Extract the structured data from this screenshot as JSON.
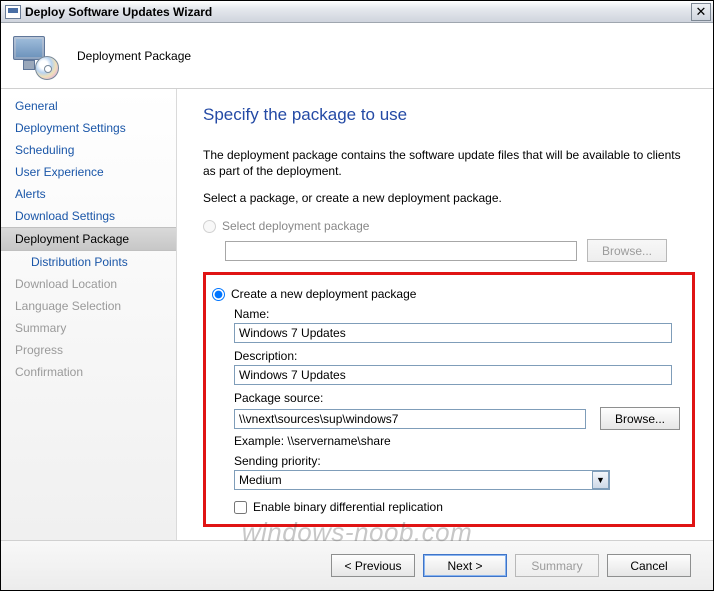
{
  "window": {
    "title": "Deploy Software Updates Wizard"
  },
  "header": {
    "step_label": "Deployment Package"
  },
  "nav": {
    "items": [
      {
        "label": "General",
        "active": false,
        "disabled": false,
        "sub": false
      },
      {
        "label": "Deployment Settings",
        "active": false,
        "disabled": false,
        "sub": false
      },
      {
        "label": "Scheduling",
        "active": false,
        "disabled": false,
        "sub": false
      },
      {
        "label": "User Experience",
        "active": false,
        "disabled": false,
        "sub": false
      },
      {
        "label": "Alerts",
        "active": false,
        "disabled": false,
        "sub": false
      },
      {
        "label": "Download Settings",
        "active": false,
        "disabled": false,
        "sub": false
      },
      {
        "label": "Deployment Package",
        "active": true,
        "disabled": false,
        "sub": false
      },
      {
        "label": "Distribution Points",
        "active": false,
        "disabled": false,
        "sub": true
      },
      {
        "label": "Download Location",
        "active": false,
        "disabled": true,
        "sub": false
      },
      {
        "label": "Language Selection",
        "active": false,
        "disabled": true,
        "sub": false
      },
      {
        "label": "Summary",
        "active": false,
        "disabled": true,
        "sub": false
      },
      {
        "label": "Progress",
        "active": false,
        "disabled": true,
        "sub": false
      },
      {
        "label": "Confirmation",
        "active": false,
        "disabled": true,
        "sub": false
      }
    ]
  },
  "main": {
    "title": "Specify the package to use",
    "intro": "The deployment package contains the software update files that will be available to clients as part of the deployment.",
    "select_prompt": "Select a package, or create a new deployment package.",
    "radio_select_label": "Select deployment package",
    "radio_create_label": "Create a new deployment package",
    "browse_label": "Browse...",
    "name_label": "Name:",
    "name_value": "Windows 7 Updates",
    "desc_label": "Description:",
    "desc_value": "Windows 7 Updates",
    "src_label": "Package source:",
    "src_value": "\\\\vnext\\sources\\sup\\windows7",
    "example_label": "Example: \\\\servername\\share",
    "priority_label": "Sending priority:",
    "priority_value": "Medium",
    "binary_repl_label": "Enable binary differential replication"
  },
  "footer": {
    "previous": "< Previous",
    "next": "Next >",
    "summary": "Summary",
    "cancel": "Cancel"
  },
  "watermark": "windows-noob.com"
}
